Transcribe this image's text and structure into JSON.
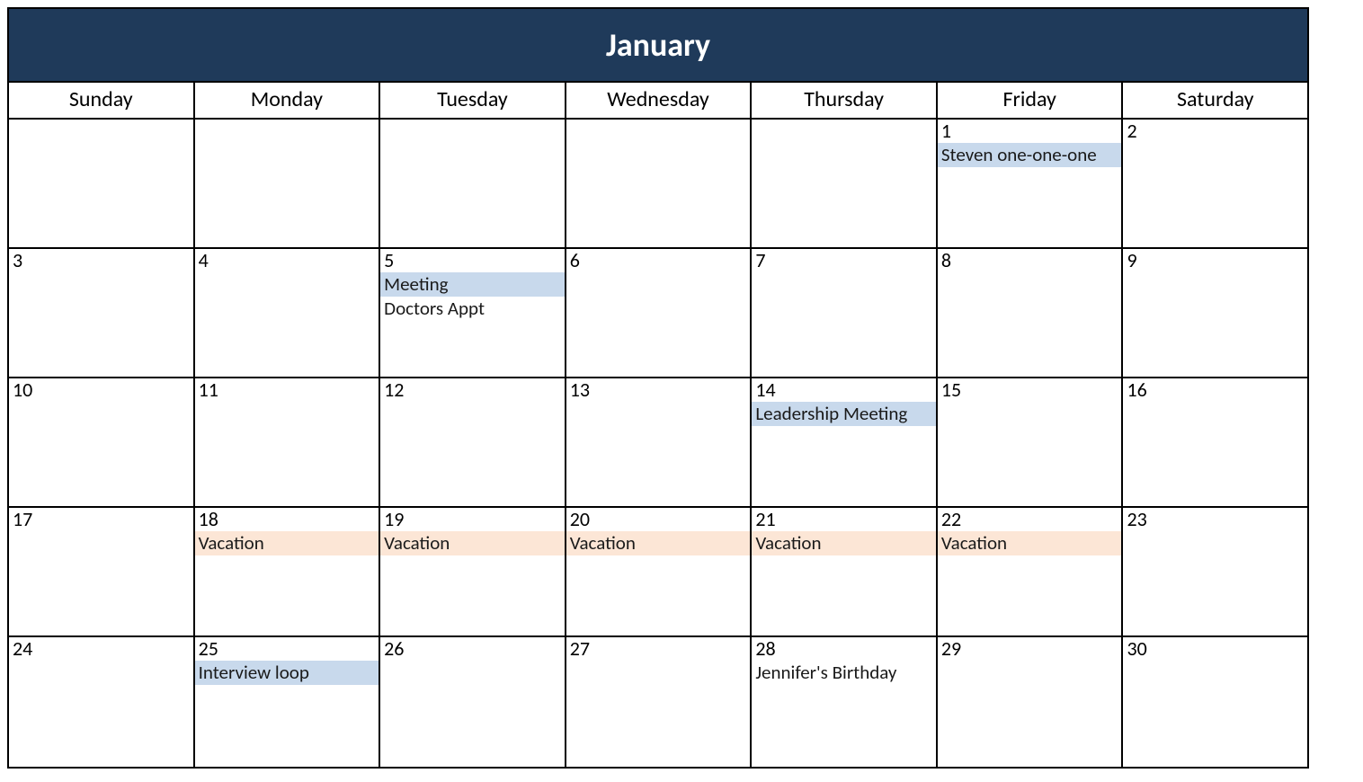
{
  "title": "January",
  "dayNames": [
    "Sunday",
    "Monday",
    "Tuesday",
    "Wednesday",
    "Thursday",
    "Friday",
    "Saturday"
  ],
  "weeks": [
    [
      {
        "num": "",
        "events": []
      },
      {
        "num": "",
        "events": []
      },
      {
        "num": "",
        "events": []
      },
      {
        "num": "",
        "events": []
      },
      {
        "num": "",
        "events": []
      },
      {
        "num": "1",
        "events": [
          {
            "label": "Steven one-one-one",
            "style": "blue"
          }
        ]
      },
      {
        "num": "2",
        "events": []
      }
    ],
    [
      {
        "num": "3",
        "events": []
      },
      {
        "num": "4",
        "events": []
      },
      {
        "num": "5",
        "events": [
          {
            "label": "Meeting",
            "style": "blue"
          },
          {
            "label": "Doctors Appt",
            "style": "plain"
          }
        ]
      },
      {
        "num": "6",
        "events": []
      },
      {
        "num": "7",
        "events": []
      },
      {
        "num": "8",
        "events": []
      },
      {
        "num": "9",
        "events": []
      }
    ],
    [
      {
        "num": "10",
        "events": []
      },
      {
        "num": "11",
        "events": []
      },
      {
        "num": "12",
        "events": []
      },
      {
        "num": "13",
        "events": []
      },
      {
        "num": "14",
        "events": [
          {
            "label": "Leadership Meeting",
            "style": "blue"
          }
        ]
      },
      {
        "num": "15",
        "events": []
      },
      {
        "num": "16",
        "events": []
      }
    ],
    [
      {
        "num": "17",
        "events": []
      },
      {
        "num": "18",
        "events": [
          {
            "label": "Vacation",
            "style": "peach"
          }
        ]
      },
      {
        "num": "19",
        "events": [
          {
            "label": "Vacation",
            "style": "peach"
          }
        ]
      },
      {
        "num": "20",
        "events": [
          {
            "label": "Vacation",
            "style": "peach"
          }
        ]
      },
      {
        "num": "21",
        "events": [
          {
            "label": "Vacation",
            "style": "peach"
          }
        ]
      },
      {
        "num": "22",
        "events": [
          {
            "label": "Vacation",
            "style": "peach"
          }
        ]
      },
      {
        "num": "23",
        "events": []
      }
    ],
    [
      {
        "num": "24",
        "events": []
      },
      {
        "num": "25",
        "events": [
          {
            "label": "Interview loop",
            "style": "blue"
          }
        ]
      },
      {
        "num": "26",
        "events": []
      },
      {
        "num": "27",
        "events": []
      },
      {
        "num": "28",
        "events": [
          {
            "label": "Jennifer's Birthday",
            "style": "plain"
          }
        ]
      },
      {
        "num": "29",
        "events": []
      },
      {
        "num": "30",
        "events": []
      }
    ]
  ]
}
